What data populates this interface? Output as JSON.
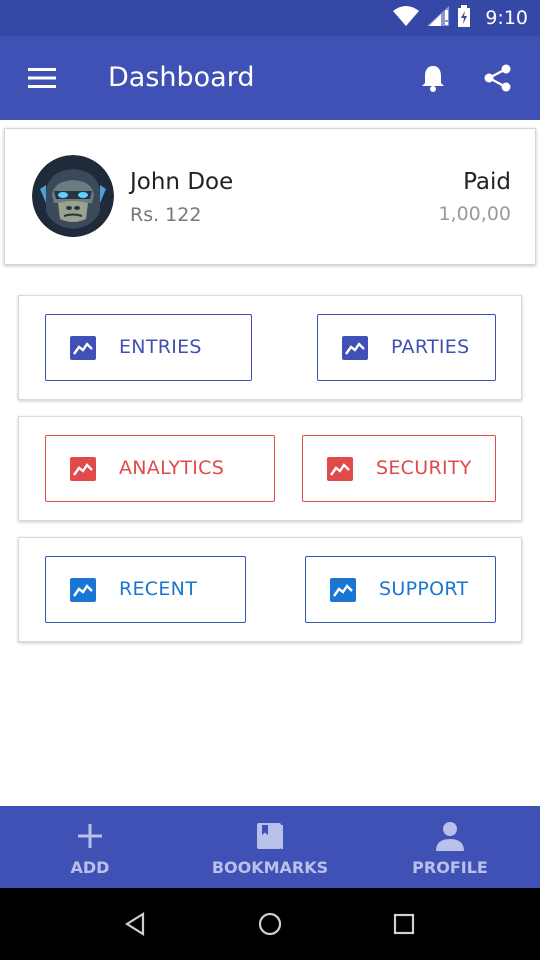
{
  "status_bar": {
    "time": "9:10",
    "icons": [
      "wifi-icon",
      "signal-icon",
      "battery-icon"
    ]
  },
  "app_bar": {
    "title": "Dashboard",
    "icons": [
      "menu-icon",
      "bell-icon",
      "share-icon"
    ]
  },
  "profile": {
    "name": "John Doe",
    "amount": "Rs. 122",
    "status": "Paid",
    "status_value": "1,00,00",
    "avatar": "gorilla-avatar"
  },
  "actions": {
    "entries": "ENTRIES",
    "parties": "PARTIES",
    "analytics": "ANALYTICS",
    "security": "SECURITY",
    "recent": "RECENT",
    "support": "SUPPORT",
    "icon": "trending-chart-icon"
  },
  "bottom_nav": {
    "add": "ADD",
    "bookmarks": "BOOKMARKS",
    "profile": "PROFILE"
  },
  "colors": {
    "primary": "#3f51b5",
    "status_bar": "#3548a5",
    "accent_red": "#e04a4a",
    "accent_blue": "#1976d2"
  }
}
